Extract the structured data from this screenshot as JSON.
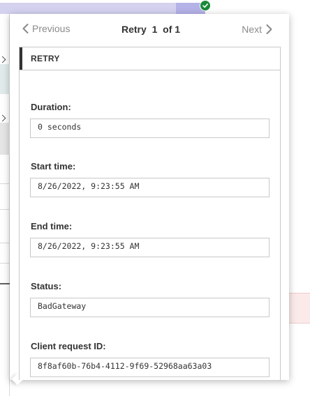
{
  "nav": {
    "previous_label": "Previous",
    "next_label": "Next",
    "title_prefix": "Retry",
    "current_index": "1",
    "of_text": "of",
    "total": "1"
  },
  "section": {
    "title": "RETRY"
  },
  "fields": {
    "duration": {
      "label": "Duration:",
      "value": "0 seconds"
    },
    "start_time": {
      "label": "Start time:",
      "value": "8/26/2022, 9:23:55 AM"
    },
    "end_time": {
      "label": "End time:",
      "value": "8/26/2022, 9:23:55 AM"
    },
    "status": {
      "label": "Status:",
      "value": "BadGateway"
    },
    "client_request_id": {
      "label": "Client request ID:",
      "value": "8f8af60b-76b4-4112-9f69-52968aa63a03"
    }
  },
  "icons": {
    "success": "check-circle-icon",
    "previous": "chevron-left-icon",
    "next": "chevron-right-icon"
  },
  "colors": {
    "success_green": "#1a8a3a",
    "nav_text": "#8a8a8a",
    "header_accent": "#333333",
    "error_tint": "#fbeaea"
  }
}
